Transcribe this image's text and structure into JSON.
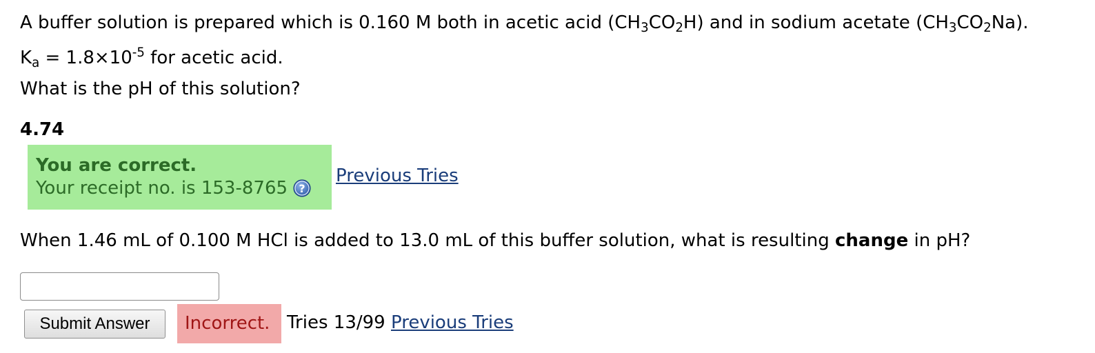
{
  "question1": {
    "intro_a": "A buffer solution is prepared which is 0.160 M both in acetic acid (CH",
    "intro_sub1": "3",
    "intro_b": "CO",
    "intro_sub2": "2",
    "intro_c": "H) and in sodium acetate (CH",
    "intro_sub3": "3",
    "intro_d": "CO",
    "intro_sub4": "2",
    "intro_e": "Na).",
    "ka_symbol": "K",
    "ka_subscript": "a",
    "ka_equals": " = 1.8×10",
    "ka_exponent": "-5",
    "ka_suffix": " for acetic acid.",
    "prompt": "What is the pH of this solution?",
    "submitted_answer": "4.74",
    "feedback_title": "You are correct.",
    "receipt_text": "Your receipt no. is 153-8765",
    "previous_tries_link": "Previous Tries"
  },
  "question2": {
    "prompt_a": "When 1.46 mL of 0.100 M HCl is added to 13.0 mL of this buffer solution, what is resulting ",
    "prompt_bold": "change",
    "prompt_b": " in pH?",
    "answer_value": "",
    "submit_label": "Submit Answer",
    "status": "Incorrect.",
    "tries": "Tries 13/99",
    "previous_tries_link": "Previous Tries"
  },
  "colors": {
    "correct_bg": "#a6eb9a",
    "correct_text": "#2c6b27",
    "incorrect_bg": "#f2a9a9",
    "incorrect_text": "#a01616",
    "link": "#1a3d7a"
  },
  "icons": {
    "help": "help-question-icon"
  }
}
